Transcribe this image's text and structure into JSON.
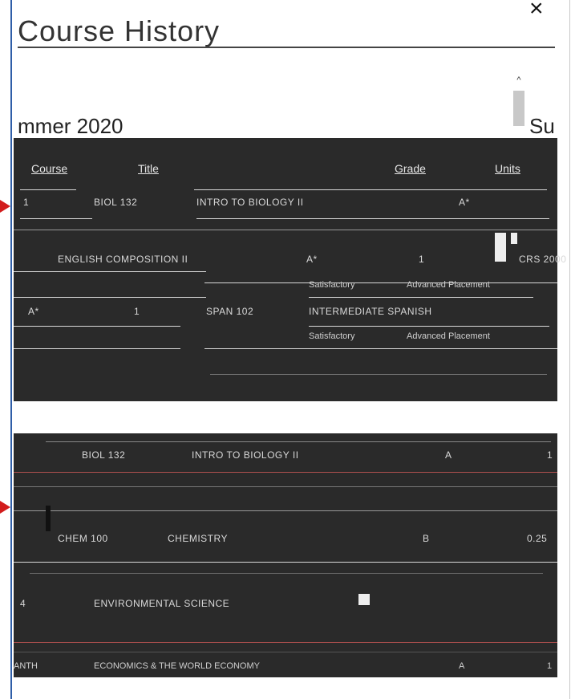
{
  "dialog": {
    "title": "Course History",
    "close_label": "×",
    "scroll_up_label": "^",
    "term_left": "mmer 2020",
    "term_right": "Su"
  },
  "table1": {
    "headers": [
      "Course",
      "Title",
      "Grade",
      "Units"
    ],
    "rows": [
      {
        "course": "1",
        "code": "BIOL 132",
        "title": "INTRO TO BIOLOGY II",
        "grade": "A*"
      },
      {
        "course": "ENGLISH COMPOSITION II",
        "code": "",
        "title": "A*",
        "grade": "1",
        "units": "CRS 2000"
      },
      {
        "course": "",
        "code": "",
        "title": "Satisfactory",
        "grade": "Advanced Placement"
      },
      {
        "course": "A*",
        "code": "1",
        "title": "SPAN 102",
        "grade": "INTERMEDIATE SPANISH"
      },
      {
        "course": "",
        "code": "",
        "title": "Satisfactory",
        "grade": "Advanced Placement"
      }
    ]
  },
  "table2": {
    "rows": [
      {
        "course": "BIOL 132",
        "title": "INTRO TO BIOLOGY II",
        "grade": "A",
        "units": "1"
      },
      {
        "course": "CHEM 100",
        "title": "CHEMISTRY",
        "grade": "B",
        "units": "0.25"
      },
      {
        "course": "4",
        "title": "ENVIRONMENTAL SCIENCE",
        "grade": "",
        "units": ""
      },
      {
        "course": "ANTH",
        "title": "ECONOMICS & THE WORLD ECONOMY",
        "grade": "A",
        "units": "1"
      }
    ]
  }
}
